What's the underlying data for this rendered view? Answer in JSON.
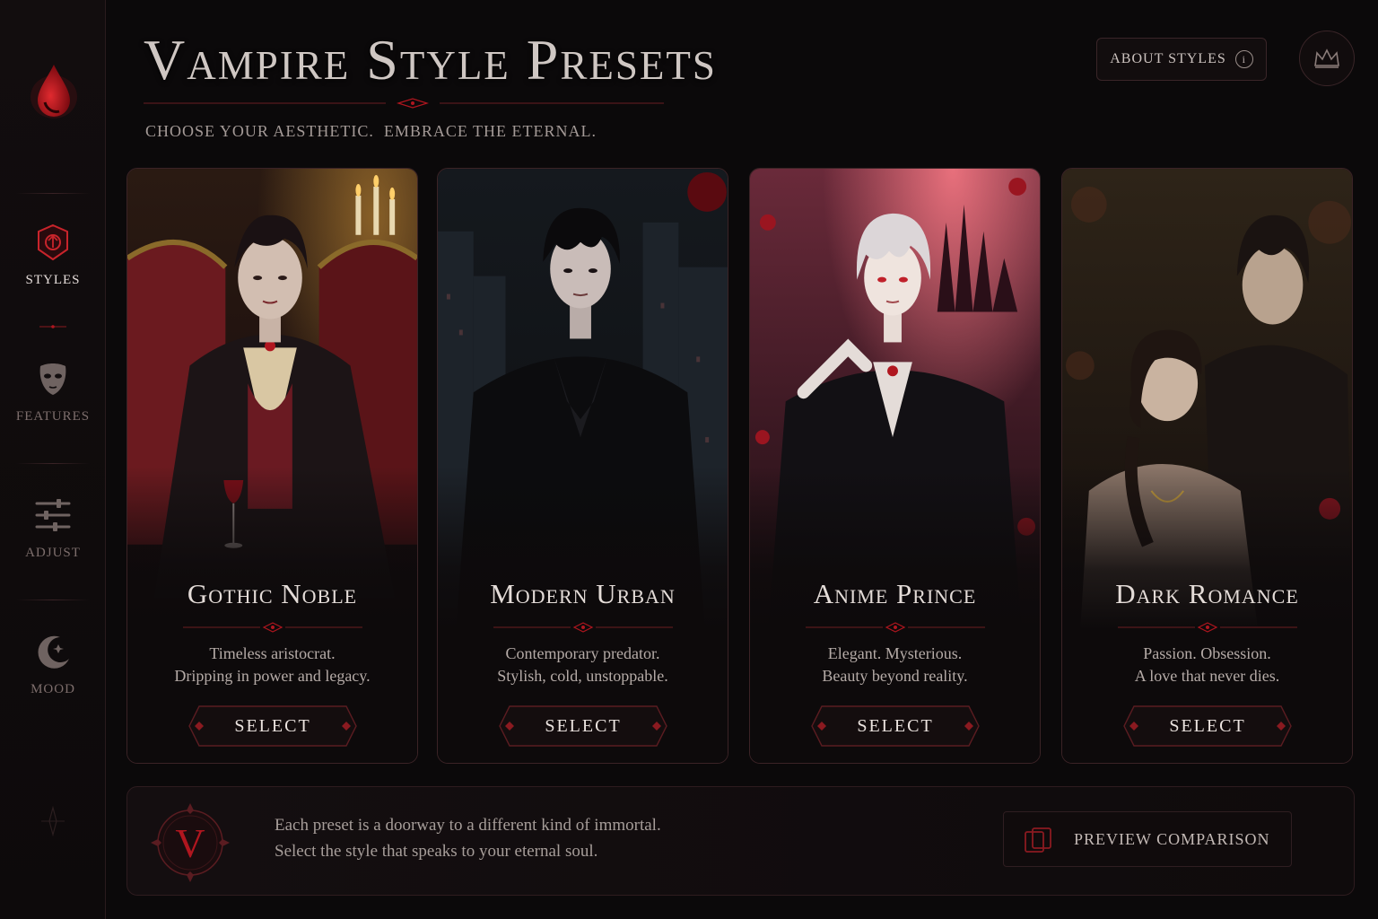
{
  "header": {
    "title": "Vampire Style Presets",
    "subtitle": "CHOOSE YOUR AESTHETIC.  EMBRACE THE ETERNAL.",
    "about_label": "ABOUT STYLES",
    "about_icon": "i"
  },
  "sidebar": {
    "logo_icon": "blood-drop-icon",
    "items": [
      {
        "label": "STYLES",
        "icon": "shield-emblem-icon",
        "active": true
      },
      {
        "label": "FEATURES",
        "icon": "mask-icon",
        "active": false
      },
      {
        "label": "ADJUST",
        "icon": "sliders-icon",
        "active": false
      },
      {
        "label": "MOOD",
        "icon": "crescent-moon-icon",
        "active": false
      }
    ]
  },
  "cards": [
    {
      "name": "Gothic Noble",
      "desc1": "Timeless aristocrat.",
      "desc2": "Dripping in power and legacy.",
      "select": "SELECT"
    },
    {
      "name": "Modern Urban",
      "desc1": "Contemporary predator.",
      "desc2": "Stylish, cold, unstoppable.",
      "select": "SELECT"
    },
    {
      "name": "Anime Prince",
      "desc1": "Elegant. Mysterious.",
      "desc2": "Beauty beyond reality.",
      "select": "SELECT"
    },
    {
      "name": "Dark Romance",
      "desc1": "Passion. Obsession.",
      "desc2": "A love that never dies.",
      "select": "SELECT"
    }
  ],
  "footer": {
    "seal_letter": "V",
    "line1": "Each preset is a doorway to a different kind of immortal.",
    "line2": "Select the style that speaks to your eternal soul.",
    "preview_label": "PREVIEW COMPARISON"
  },
  "colors": {
    "accent": "#b0161f",
    "background": "#0b090a",
    "border": "#3b2326",
    "text": "#d8d0cc"
  }
}
